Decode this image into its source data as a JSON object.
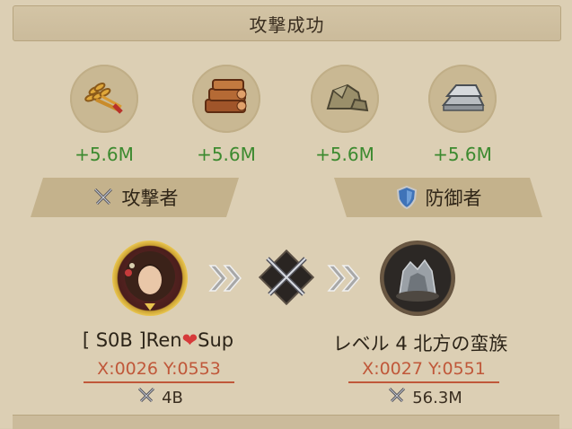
{
  "title": "攻撃成功",
  "resources": [
    {
      "name": "food",
      "icon": "wheat-icon",
      "amount": "+5.6M"
    },
    {
      "name": "wood",
      "icon": "wood-logs-icon",
      "amount": "+5.6M"
    },
    {
      "name": "stone",
      "icon": "stone-icon",
      "amount": "+5.6M"
    },
    {
      "name": "iron",
      "icon": "iron-ingot-icon",
      "amount": "+5.6M"
    }
  ],
  "attacker_label": "攻撃者",
  "defender_label": "防御者",
  "attacker": {
    "name_prefix": "[ S0B ]Ren",
    "name_suffix": "Sup",
    "coords": "X:0026 Y:0553",
    "power": "4B"
  },
  "defender": {
    "name": "レベル 4 北方の蛮族",
    "coords": "X:0027 Y:0551",
    "power": "56.3M"
  },
  "colors": {
    "amount_green": "#3c8a2f",
    "coord_red": "#c0583a",
    "background": "#dccfb4"
  }
}
